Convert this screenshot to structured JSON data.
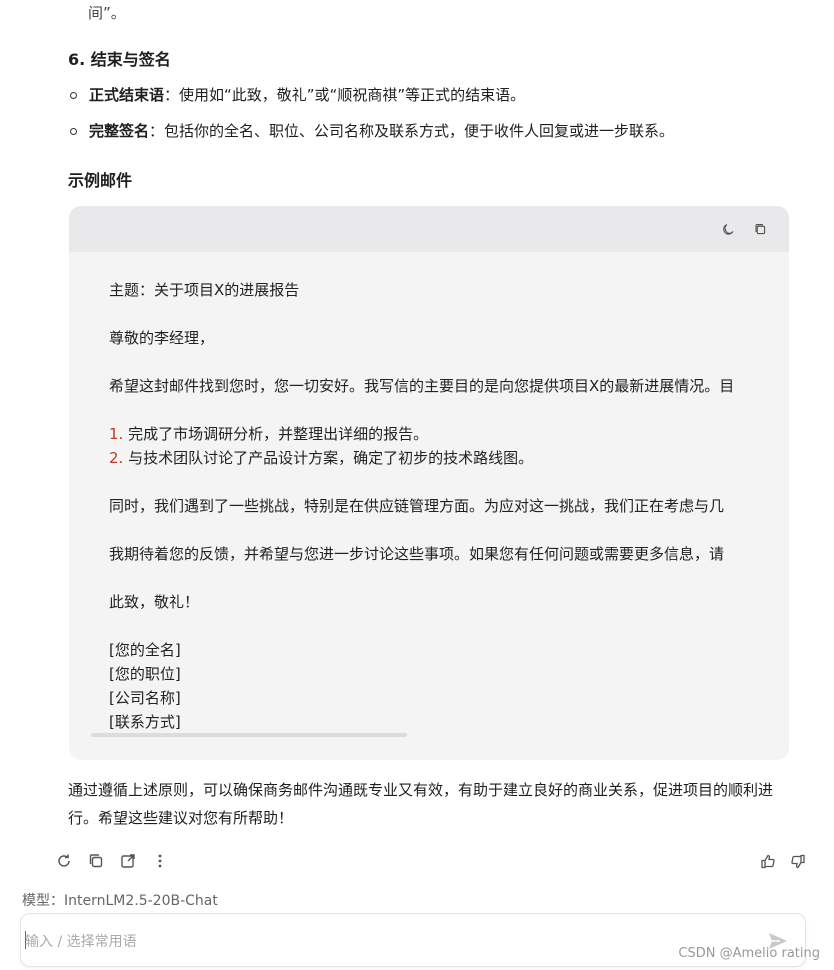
{
  "continued_text": "间”。",
  "section": {
    "title": "6. 结束与签名"
  },
  "bullets": [
    {
      "bold": "正式结束语",
      "text": "：使用如“此致，敬礼”或“顺祝商祺”等正式的结束语。"
    },
    {
      "bold": "完整签名",
      "text": "：包括你的全名、职位、公司名称及联系方式，便于收件人回复或进一步联系。"
    }
  ],
  "example_title": "示例邮件",
  "code_card": {
    "icons": [
      "theme-moon-icon",
      "copy-icon"
    ],
    "lines": {
      "subject": "主题：关于项目X的进展报告",
      "greeting": "尊敬的李经理，",
      "intro": "希望这封邮件找到您时，您一切安好。我写信的主要目的是向您提供项目X的最新进展情况。目",
      "item1_num": "1.",
      "item1": " 完成了市场调研分析，并整理出详细的报告。",
      "item2_num": "2.",
      "item2": " 与技术团队讨论了产品设计方案，确定了初步的技术路线图。",
      "challenge": "同时，我们遇到了一些挑战，特别是在供应链管理方面。为应对这一挑战，我们正在考虑与几",
      "closing_request": "我期待着您的反馈，并希望与您进一步讨论这些事项。如果您有任何问题或需要更多信息，请",
      "signoff": "此致，敬礼！",
      "sig_name": "[您的全名]",
      "sig_title": "[您的职位]",
      "sig_company": "[公司名称]",
      "sig_contact": "[联系方式]"
    }
  },
  "summary": "通过遵循上述原则，可以确保商务邮件沟通既专业又有效，有助于建立良好的商业关系，促进项目的顺利进行。希望这些建议对您有所帮助！",
  "model_label": "模型：InternLM2.5-20B-Chat",
  "input": {
    "placeholder": "输入 / 选择常用语"
  },
  "credit": "CSDN @Amelio rating"
}
